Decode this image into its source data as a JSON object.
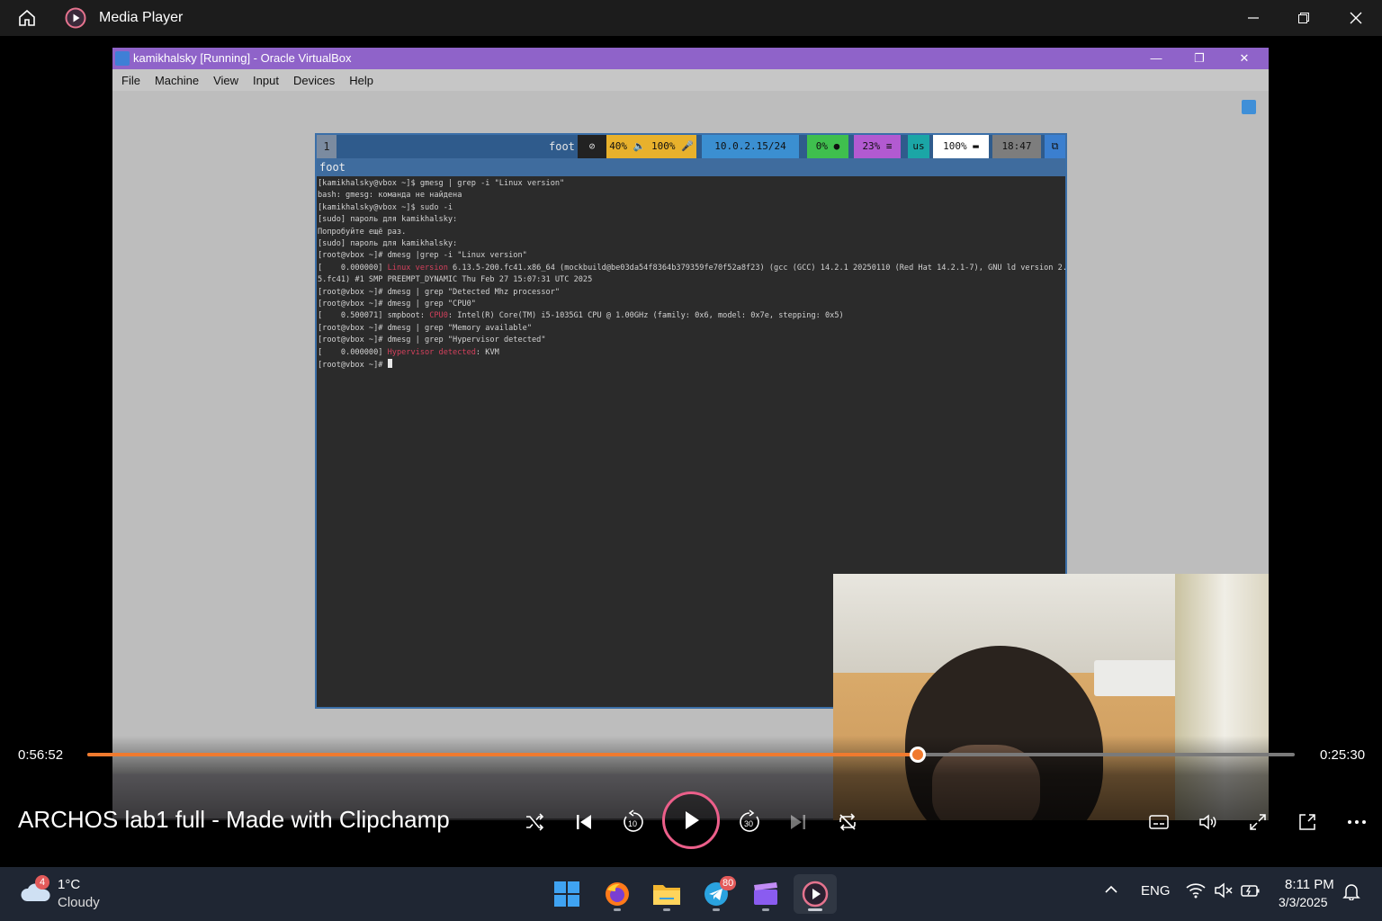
{
  "player": {
    "app_title": "Media Player",
    "media_title": "ARCHOS lab1 full - Made with Clipchamp",
    "time_elapsed": "0:56:52",
    "time_remaining": "0:25:30",
    "progress_fraction": 0.688,
    "accent_color": "#f07a2e"
  },
  "virtualbox": {
    "window_title": "kamikhalsky [Running] - Oracle VirtualBox",
    "menu": [
      "File",
      "Machine",
      "View",
      "Input",
      "Devices",
      "Help"
    ]
  },
  "guest": {
    "workspace": "1",
    "bar_app": "foot",
    "window_title": "foot",
    "modules": [
      {
        "text": "40% 🔈 100% 🎤",
        "color": "#e8b12c"
      },
      {
        "text": "10.0.2.15/24",
        "color": "#3b8fd1"
      },
      {
        "text": "0% ●",
        "color": "#3fbf4e"
      },
      {
        "text": "23% ≡",
        "color": "#b25ad1"
      },
      {
        "text": "us",
        "color": "#1ba6a6"
      },
      {
        "text": "100% ▬",
        "color": "#ffffff"
      },
      {
        "text": "18:47",
        "color": "#7d7d7d"
      },
      {
        "text": "⧉",
        "color": "#3b7fcf"
      }
    ],
    "terminal_lines": [
      {
        "a": "[kamikhalsky@vbox ~]$ gmesg | grep -i \"Linux version\"",
        "r": "",
        "b": ""
      },
      {
        "a": "bash: gmesg: команда не найдена",
        "r": "",
        "b": ""
      },
      {
        "a": "[kamikhalsky@vbox ~]$ sudo -i",
        "r": "",
        "b": ""
      },
      {
        "a": "[sudo] пароль для kamikhalsky:",
        "r": "",
        "b": ""
      },
      {
        "a": "Попробуйте ещё раз.",
        "r": "",
        "b": ""
      },
      {
        "a": "[sudo] пароль для kamikhalsky:",
        "r": "",
        "b": ""
      },
      {
        "a": "[root@vbox ~]# dmesg |grep -i \"Linux version\"",
        "r": "",
        "b": ""
      },
      {
        "a": "[    0.000000] ",
        "r": "Linux version",
        "b": " 6.13.5-200.fc41.x86_64 (mockbuild@be03da54f8364b379359fe70f52a8f23) (gcc (GCC) 14.2.1 20250110 (Red Hat 14.2.1-7), GNU ld version 2.43.1-"
      },
      {
        "a": "5.fc41) #1 SMP PREEMPT_DYNAMIC Thu Feb 27 15:07:31 UTC 2025",
        "r": "",
        "b": ""
      },
      {
        "a": "[root@vbox ~]# dmesg | grep \"Detected Mhz processor\"",
        "r": "",
        "b": ""
      },
      {
        "a": "[root@vbox ~]# dmesg | grep \"CPU0\"",
        "r": "",
        "b": ""
      },
      {
        "a": "[    0.500071] smpboot: ",
        "r": "CPU0",
        "b": ": Intel(R) Core(TM) i5-1035G1 CPU @ 1.00GHz (family: 0x6, model: 0x7e, stepping: 0x5)"
      },
      {
        "a": "[root@vbox ~]# dmesg | grep \"Memory available\"",
        "r": "",
        "b": ""
      },
      {
        "a": "[root@vbox ~]# dmesg | grep \"Hypervisor detected\"",
        "r": "",
        "b": ""
      },
      {
        "a": "[    0.000000] ",
        "r": "Hypervisor detected",
        "b": ": KVM"
      },
      {
        "a": "[root@vbox ~]# ",
        "r": "",
        "b": "",
        "cursor": true
      }
    ]
  },
  "taskbar": {
    "weather_temp": "1°C",
    "weather_condition": "Cloudy",
    "weather_badge": "4",
    "telegram_badge": "80",
    "language": "ENG",
    "time": "8:11 PM",
    "date": "3/3/2025"
  }
}
